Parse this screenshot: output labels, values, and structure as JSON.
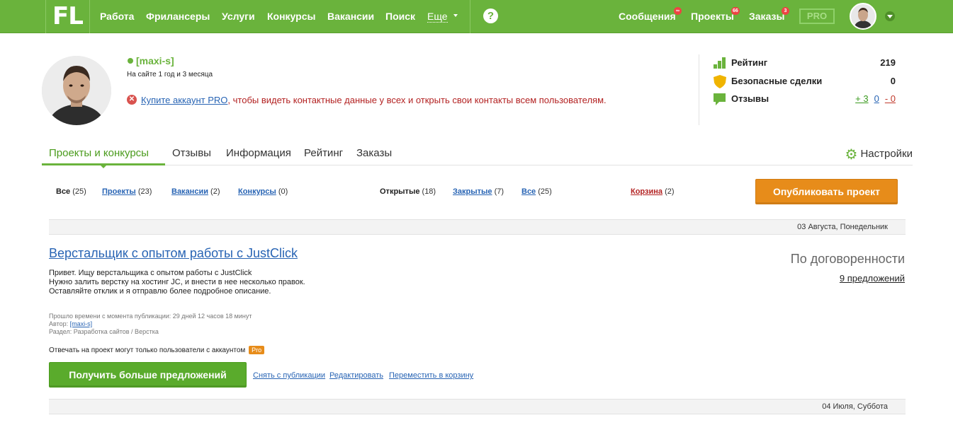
{
  "topbar": {
    "logo": "FL",
    "nav": [
      "Работа",
      "Фрилансеры",
      "Услуги",
      "Конкурсы",
      "Вакансии",
      "Поиск"
    ],
    "more": "Еще",
    "help": "?",
    "messages": {
      "label": "Сообщения",
      "badge": "∞"
    },
    "projects": {
      "label": "Проекты",
      "badge": "66"
    },
    "orders": {
      "label": "Заказы",
      "badge": "3"
    },
    "pro": "PRO"
  },
  "profile": {
    "username": "[maxi-s]",
    "on_site": "На сайте 1 год и 3 месяца",
    "warning_link": "Купите аккаунт PRO",
    "warning_text": ", чтобы видеть контактные данные у всех и открыть свои контакты всем пользователям."
  },
  "stats": {
    "rating": {
      "label": "Рейтинг",
      "value": "219"
    },
    "safe_deals": {
      "label": "Безопасные сделки",
      "value": "0"
    },
    "reviews": {
      "label": "Отзывы",
      "positive": "+ 3",
      "neutral": "0",
      "negative": "- 0"
    }
  },
  "tabs": {
    "items": [
      "Проекты и конкурсы",
      "Отзывы",
      "Информация",
      "Рейтинг",
      "Заказы"
    ],
    "active": 0,
    "settings": "Настройки"
  },
  "filters": {
    "all": {
      "label": "Все",
      "count": "(25)"
    },
    "projects": {
      "label": "Проекты",
      "count": "(23)"
    },
    "vacancies": {
      "label": "Вакансии",
      "count": "(2)"
    },
    "contests": {
      "label": "Конкурсы",
      "count": "(0)"
    },
    "open": {
      "label": "Открытые",
      "count": "(18)"
    },
    "closed": {
      "label": "Закрытые",
      "count": "(7)"
    },
    "all2": {
      "label": "Все",
      "count": "(25)"
    },
    "trash": {
      "label": "Корзина",
      "count": "(2)"
    },
    "publish_button": "Опубликовать проект"
  },
  "date1": "03 Августа, Понедельник",
  "project": {
    "title": "Верстальщик с опытом работы с JustClick",
    "desc": [
      "Привет. Ищу верстальщика с опытом работы с JustClick",
      "Нужно залить верстку на хостинг JC, и внести в нее несколько правок.",
      "Оставляйте отклик и я отправлю более подробное описание."
    ],
    "elapsed": "Прошло времени с момента публикации: 29 дней 12 часов 18 минут",
    "author_label": "Автор:",
    "author": "[maxi-s]",
    "section": "Раздел: Разработка сайтов / Верстка",
    "price": "По договоренности",
    "offers": "9 предложений",
    "pro_only": "Отвечать на проект могут только пользователи с аккаунтом",
    "pro_badge": "Pro",
    "more_button": "Получить больше предложений",
    "unpublish": "Снять с публикации",
    "edit": "Редактировать",
    "move_trash": "Переместить в корзину"
  },
  "date2": "04 Июля, Суббота",
  "colors": {
    "brand_green": "#6ab33c",
    "accent_orange": "#e78c1a",
    "link_blue": "#2864b4",
    "warn_red": "#b32222"
  }
}
